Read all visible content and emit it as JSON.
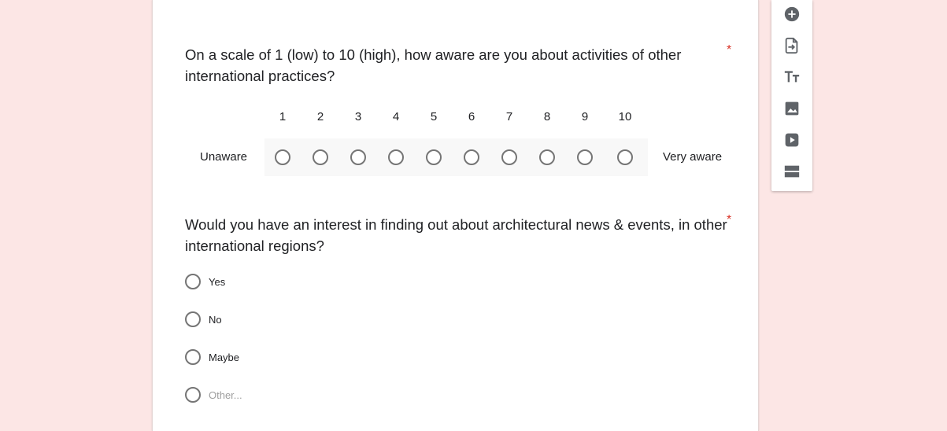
{
  "questions": [
    {
      "title": "On a scale of 1 (low) to 10 (high), how aware are you about activities of other international practices?",
      "required_mark": "*",
      "scale": {
        "numbers": [
          "1",
          "2",
          "3",
          "4",
          "5",
          "6",
          "7",
          "8",
          "9",
          "10"
        ],
        "low_label": "Unaware",
        "high_label": "Very aware"
      }
    },
    {
      "title": "Would you have an interest in finding out about architectural news & events, in other international regions?",
      "required_mark": "*",
      "options": [
        "Yes",
        "No",
        "Maybe",
        "Other..."
      ]
    }
  ],
  "toolbar": {
    "items": [
      "add-question-icon",
      "import-questions-icon",
      "add-title-icon",
      "add-image-icon",
      "add-video-icon",
      "add-section-icon"
    ]
  },
  "colors": {
    "background": "#fce6e5",
    "card": "#ffffff",
    "required": "#d93025",
    "icon": "#5f6368",
    "radio_border": "#757575"
  }
}
